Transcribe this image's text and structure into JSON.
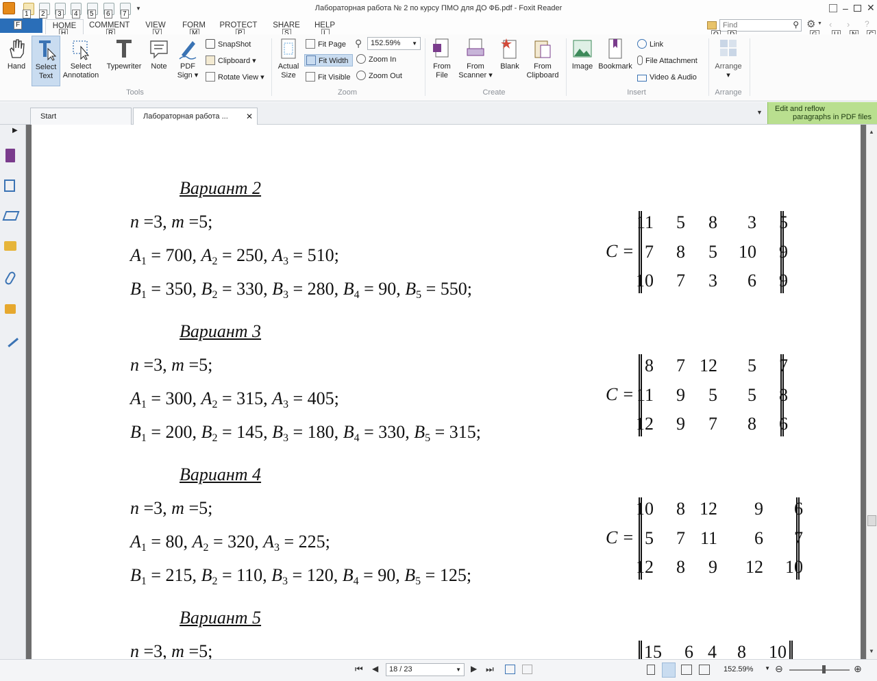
{
  "window": {
    "title": "Лабораторная работа № 2 по курсу ПМО для ДО ФБ.pdf - Foxit Reader",
    "quick_access_keytips": [
      "1",
      "2",
      "3",
      "4",
      "5",
      "6",
      "7"
    ],
    "keytips": {
      "file": "F",
      "home": "H",
      "comment": "R",
      "view": "V",
      "form": "M",
      "protect": "P",
      "share": "S",
      "help": "L",
      "find": "Q",
      "find2": "D",
      "g": "G",
      "u": "U",
      "n": "N",
      "c": "C"
    }
  },
  "ribbon_tabs": [
    "FILE",
    "HOME",
    "COMMENT",
    "VIEW",
    "FORM",
    "PROTECT",
    "SHARE",
    "HELP"
  ],
  "search": {
    "placeholder": "Find"
  },
  "ribbon": {
    "tools": {
      "hand": "Hand",
      "select_text_1": "Select",
      "select_text_2": "Text",
      "select_annotation_1": "Select",
      "select_annotation_2": "Annotation",
      "typewriter": "Typewriter",
      "note": "Note",
      "pdf_sign_1": "PDF",
      "pdf_sign_2": "Sign",
      "snapshot": "SnapShot",
      "clipboard": "Clipboard",
      "rotate_view": "Rotate View",
      "group": "Tools"
    },
    "zoom": {
      "actual_size_1": "Actual",
      "actual_size_2": "Size",
      "fit_page": "Fit Page",
      "fit_width": "Fit Width",
      "fit_visible": "Fit Visible",
      "zoom_value": "152.59%",
      "zoom_in": "Zoom In",
      "zoom_out": "Zoom Out",
      "group": "Zoom"
    },
    "create": {
      "from_file_1": "From",
      "from_file_2": "File",
      "from_scanner_1": "From",
      "from_scanner_2": "Scanner",
      "blank": "Blank",
      "from_clipboard_1": "From",
      "from_clipboard_2": "Clipboard",
      "group": "Create"
    },
    "insert": {
      "image": "Image",
      "bookmark": "Bookmark",
      "link": "Link",
      "file_attachment": "File Attachment",
      "video_audio": "Video & Audio",
      "group": "Insert"
    },
    "arrange": {
      "arrange": "Arrange",
      "group": "Arrange"
    }
  },
  "promo": {
    "line1": "Edit and reflow",
    "line2": "paragraphs in PDF files"
  },
  "doc_tabs": [
    {
      "label": "Start"
    },
    {
      "label": "Лабораторная работа ..."
    }
  ],
  "document": {
    "variants": [
      {
        "heading": "Вариант 2",
        "nm": "n =3, m =5;",
        "A": [
          [
            "A",
            "1",
            " = 700, "
          ],
          [
            "A",
            "2",
            " = 250, "
          ],
          [
            "A",
            "3",
            " = 510;"
          ]
        ],
        "B": [
          [
            "B",
            "1",
            " = 350, "
          ],
          [
            "B",
            "2",
            " = 330, "
          ],
          [
            "B",
            "3",
            " = 280, "
          ],
          [
            "B",
            "4",
            " = 90, "
          ],
          [
            "B",
            "5",
            " = 550;"
          ]
        ],
        "matrix": [
          [
            "11",
            "5",
            "8",
            "3",
            "5"
          ],
          [
            "7",
            "8",
            "5",
            "10",
            "9"
          ],
          [
            "10",
            "7",
            "3",
            "6",
            "9"
          ]
        ]
      },
      {
        "heading": "Вариант 3",
        "nm": "n =3, m =5;",
        "A": [
          [
            "A",
            "1",
            " = 300, "
          ],
          [
            "A",
            "2",
            " = 315, "
          ],
          [
            "A",
            "3",
            " = 405;"
          ]
        ],
        "B": [
          [
            "B",
            "1",
            " = 200, "
          ],
          [
            "B",
            "2",
            " = 145, "
          ],
          [
            "B",
            "3",
            " = 180, "
          ],
          [
            "B",
            "4",
            " = 330, "
          ],
          [
            "B",
            "5",
            " = 315;"
          ]
        ],
        "matrix": [
          [
            "8",
            "7",
            "12",
            "5",
            "7"
          ],
          [
            "11",
            "9",
            "5",
            "5",
            "8"
          ],
          [
            "12",
            "9",
            "7",
            "8",
            "6"
          ]
        ]
      },
      {
        "heading": "Вариант 4",
        "nm": "n =3, m =5;",
        "A": [
          [
            "A",
            "1",
            " = 80, "
          ],
          [
            "A",
            "2",
            " = 320, "
          ],
          [
            "A",
            "3",
            " = 225;"
          ]
        ],
        "B": [
          [
            "B",
            "1",
            " = 215, "
          ],
          [
            "B",
            "2",
            " = 110, "
          ],
          [
            "B",
            "3",
            " = 120, "
          ],
          [
            "B",
            "4",
            " = 90, "
          ],
          [
            "B",
            "5",
            " = 125;"
          ]
        ],
        "matrix": [
          [
            "10",
            "8",
            "12",
            "9",
            "6"
          ],
          [
            "5",
            "7",
            "11",
            "6",
            "7"
          ],
          [
            "12",
            "8",
            "9",
            "12",
            "10"
          ]
        ]
      },
      {
        "heading": "Вариант 5",
        "nm": "n =3, m =5;",
        "matrix_partial": [
          "15",
          "6",
          "4",
          "8",
          "10"
        ]
      }
    ],
    "matrix_label": "C ="
  },
  "statusbar": {
    "page": "18 / 23",
    "zoom": "152.59%"
  }
}
